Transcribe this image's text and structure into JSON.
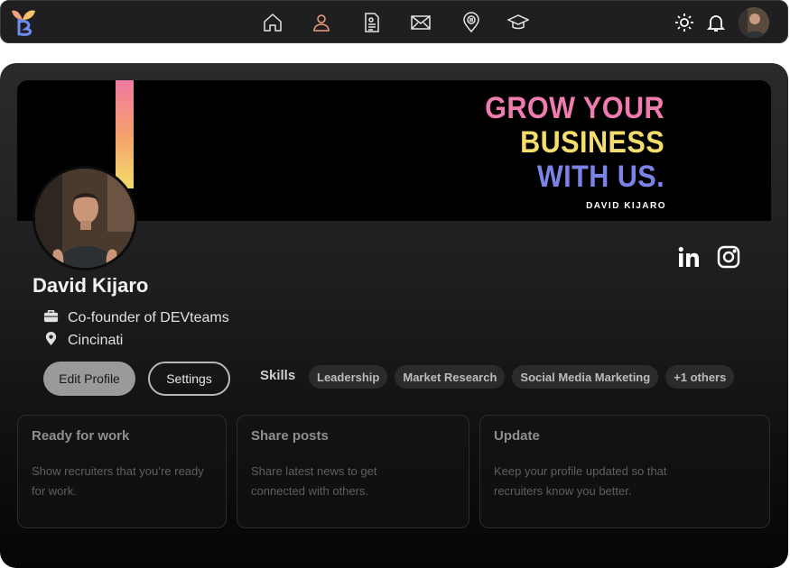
{
  "nav": {
    "icons": [
      "home-icon",
      "profile-icon",
      "resume-icon",
      "mail-icon",
      "location-icon",
      "graduation-cap-icon"
    ],
    "active_icon": "profile-icon",
    "right_icons": [
      "theme-toggle-icon",
      "notification-bell-icon"
    ],
    "active_color": "#f4a07a"
  },
  "banner": {
    "headline_line1": "GROW YOUR",
    "headline_line2": "BUSINESS",
    "headline_line3": "WITH US.",
    "name": "DAVID KIJARO",
    "colors": {
      "pink": "#ef7bb0",
      "yellow": "#f5dd6b",
      "blue": "#7b83e6"
    }
  },
  "profile": {
    "name": "David Kijaro",
    "role": "Co-founder of DEVteams",
    "location": "Cincinati",
    "social": [
      "linkedin-icon",
      "instagram-icon"
    ]
  },
  "actions": {
    "edit_label": "Edit Profile",
    "settings_label": "Settings"
  },
  "skills": {
    "label": "Skills",
    "items": [
      "Leadership",
      "Market Research",
      "Social Media Marketing",
      "+1 others"
    ]
  },
  "tiles": [
    {
      "title": "Ready for work",
      "description": "Show recruiters that you’re ready for work."
    },
    {
      "title": "Share posts",
      "description": "Share latest news to get connected with others."
    },
    {
      "title": "Update",
      "description": "Keep your profile updated so that recruiters know you better."
    }
  ]
}
